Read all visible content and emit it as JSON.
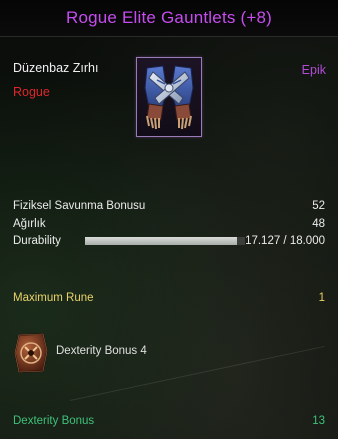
{
  "title": "Rogue Elite Gauntlets (+8)",
  "item": {
    "type": "Düzenbaz Zırhı",
    "class": "Rogue",
    "rarity": "Epik",
    "icon": "gauntlets-icon"
  },
  "stats": [
    {
      "label": "Fiziksel Savunma Bonusu",
      "value": "52"
    },
    {
      "label": "Ağırlık",
      "value": "48"
    }
  ],
  "durability": {
    "label": "Durability",
    "value": "17.127 / 18.000",
    "fraction": 0.9515
  },
  "rune": {
    "label": "Maximum Rune",
    "value": "1",
    "name": "Dexterity Bonus 4",
    "icon": "rune-stone-icon"
  },
  "bonus": {
    "label": "Dexterity Bonus",
    "value": "13"
  },
  "colors": {
    "title": "#c64cf0",
    "class": "#e0262c",
    "rarity": "#b04bd8",
    "rune": "#e9d26a",
    "bonus": "#3fc07a"
  }
}
